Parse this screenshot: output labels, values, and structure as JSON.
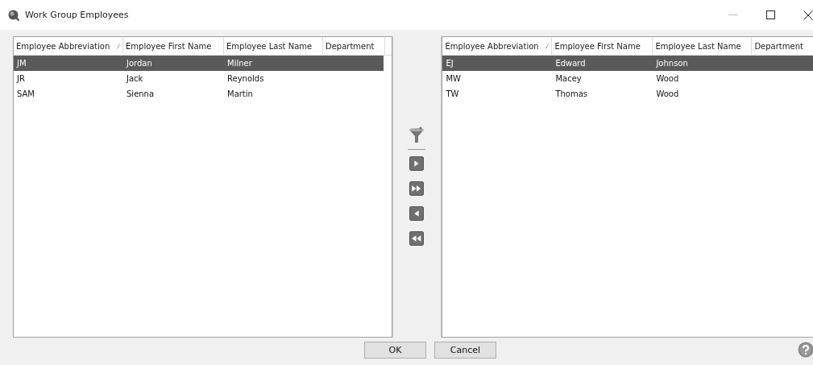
{
  "window": {
    "title": "Work Group Employees"
  },
  "left_table": {
    "columns": [
      {
        "label": "Employee Abbreviation",
        "sorted": true
      },
      {
        "label": "Employee First Name",
        "sorted": false
      },
      {
        "label": "Employee Last Name",
        "sorted": false
      },
      {
        "label": "Department",
        "sorted": false
      }
    ],
    "rows": [
      {
        "cells": [
          "JM",
          "Jordan",
          "Milner"
        ],
        "selected": true
      },
      {
        "cells": [
          "JR",
          "Jack",
          "Reynolds"
        ],
        "selected": false
      },
      {
        "cells": [
          "SAM",
          "Sienna",
          "Martin"
        ],
        "selected": false
      }
    ]
  },
  "right_table": {
    "columns": [
      {
        "label": "Employee Abbreviation",
        "sorted": true
      },
      {
        "label": "Employee First Name",
        "sorted": false
      },
      {
        "label": "Employee Last Name",
        "sorted": false
      },
      {
        "label": "Department",
        "sorted": false
      }
    ],
    "rows": [
      {
        "cells": [
          "EJ",
          "Edward",
          "Johnson"
        ],
        "selected": true
      },
      {
        "cells": [
          "MW",
          "Macey",
          "Wood"
        ],
        "selected": false
      },
      {
        "cells": [
          "TW",
          "Thomas",
          "Wood"
        ],
        "selected": false
      }
    ]
  },
  "move_buttons": [
    {
      "kind": "add"
    },
    {
      "kind": "add_all"
    },
    {
      "kind": "remove"
    },
    {
      "kind": "remove_all"
    }
  ],
  "buttons": [
    "OK",
    "Cancel"
  ]
}
